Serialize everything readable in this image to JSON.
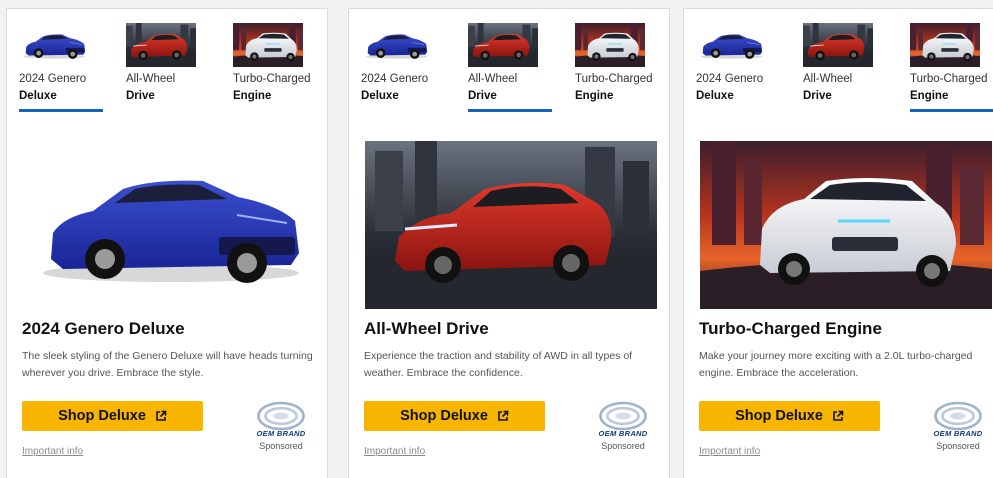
{
  "tabs": [
    {
      "line1": "2024 Genero",
      "line2": "Deluxe"
    },
    {
      "line1": "All-Wheel",
      "line2": "Drive"
    },
    {
      "line1": "Turbo-Charged",
      "line2": "Engine"
    }
  ],
  "cards": [
    {
      "active_tab": 0,
      "title": "2024 Genero Deluxe",
      "description": "The sleek styling of the Genero Deluxe will have heads turning wherever you drive. Embrace the style.",
      "cta_label": "Shop Deluxe",
      "brand_name": "OEM BRAND",
      "sponsored_label": "Sponsored",
      "important_info": "Important info"
    },
    {
      "active_tab": 1,
      "title": "All-Wheel Drive",
      "description": "Experience the traction and stability of AWD in all types of weather. Embrace the confidence.",
      "cta_label": "Shop Deluxe",
      "brand_name": "OEM BRAND",
      "sponsored_label": "Sponsored",
      "important_info": "Important info"
    },
    {
      "active_tab": 2,
      "title": "Turbo-Charged Engine",
      "description": "Make your journey more exciting with a 2.0L turbo-charged engine. Embrace the acceleration.",
      "cta_label": "Shop Deluxe",
      "brand_name": "OEM BRAND",
      "sponsored_label": "Sponsored",
      "important_info": "Important info"
    }
  ],
  "colors": {
    "accent": "#1565c0",
    "cta": "#f7b500",
    "brand": "#123a7a"
  },
  "icons": {
    "cta": "external-link-icon",
    "brand": "oem-brand-logo"
  }
}
